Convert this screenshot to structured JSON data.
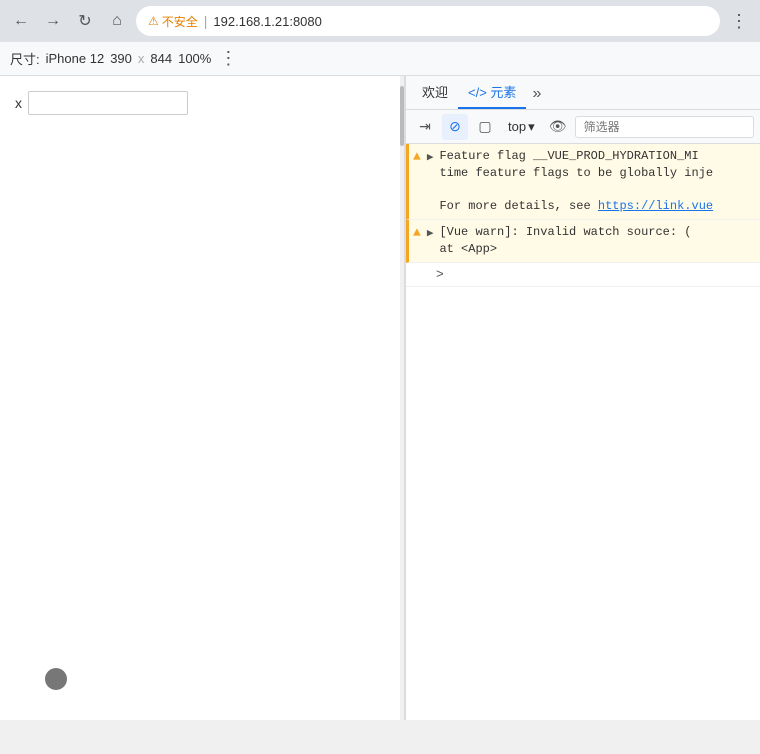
{
  "browser": {
    "back_label": "←",
    "forward_label": "→",
    "reload_label": "↻",
    "home_label": "⌂",
    "security_icon": "⚠",
    "security_text": "不安全",
    "separator": "|",
    "url": "192.168.1.21:8080",
    "menu_label": "⋮"
  },
  "device_toolbar": {
    "label_size": "尺寸:",
    "device_name": "iPhone 12",
    "width": "390",
    "x_label": "x",
    "height": "844",
    "zoom": "100%",
    "more_label": "⋮"
  },
  "mobile_content": {
    "label_x": "x",
    "input_placeholder": ""
  },
  "devtools": {
    "tabs": [
      {
        "label": "欢迎",
        "active": false
      },
      {
        "label": "</> 元素",
        "active": false
      }
    ],
    "icon_forward": "⇥",
    "icon_block": "⊘",
    "top_label": "top",
    "top_dropdown": "▾",
    "icon_eye": "👁",
    "filter_placeholder": "筛选器",
    "console_messages": [
      {
        "type": "warning",
        "icon": "▲",
        "expand": "▶",
        "text": "Feature flag __VUE_PROD_HYDRATION_MI",
        "text2": "time feature flags to be globally inje",
        "text3": "For more details, see ",
        "link": "https://link.vue",
        "link_text": "https://link.vue"
      },
      {
        "type": "warning",
        "icon": "▲",
        "expand": "▶",
        "text": "[Vue warn]: Invalid watch source:  (",
        "text2": "at <App>"
      }
    ],
    "expand_row_label": ">"
  }
}
